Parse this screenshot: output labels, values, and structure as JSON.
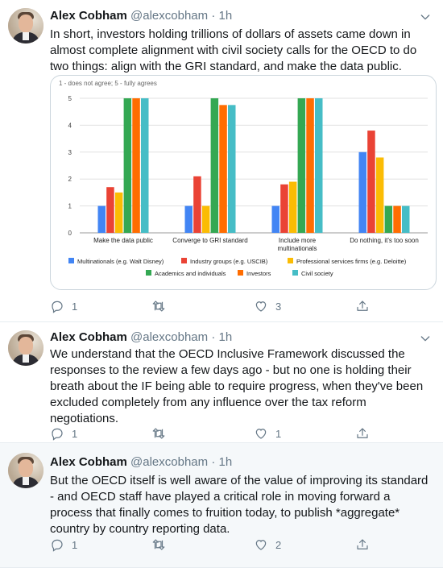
{
  "tweets": [
    {
      "name": "Alex Cobham",
      "handle": "@alexcobham",
      "dot": "·",
      "time": "1h",
      "text": "In short, investors holding trillions of dollars of assets came down in almost complete alignment with civil society calls for the OECD to do two things: align with the GRI standard, and make the data public.",
      "replies": "1",
      "retweets": "",
      "likes": "3"
    },
    {
      "name": "Alex Cobham",
      "handle": "@alexcobham",
      "dot": "·",
      "time": "1h",
      "text": "We understand that the OECD Inclusive Framework discussed the responses to the review a few days ago - but no one is holding their breath about the IF being able to require progress, when they've been excluded completely from any influence over the tax reform negotiations.",
      "replies": "1",
      "retweets": "",
      "likes": "1"
    },
    {
      "name": "Alex Cobham",
      "handle": "@alexcobham",
      "dot": "·",
      "time": "1h",
      "text": "But the OECD itself is well aware of the value of improving its standard - and OECD staff have played a critical role in moving forward a process that finally comes to fruition today, to publish *aggregate* country by country reporting data.",
      "replies": "1",
      "retweets": "",
      "likes": "2"
    }
  ],
  "chart_data": {
    "type": "bar",
    "title": "1 - does not agree; 5 - fully agrees",
    "categories": [
      "Make the data public",
      "Converge to GRI standard",
      "Include more multinationals",
      "Do nothing, it's too soon"
    ],
    "ylim": [
      0,
      5
    ],
    "yticks": [
      "0",
      "1",
      "2",
      "3",
      "4",
      "5"
    ],
    "grid": true,
    "legend_position": "bottom",
    "series": [
      {
        "name": "Multinationals (e.g. Walt Disney)",
        "color": "#4285f4",
        "values": [
          1.0,
          1.0,
          1.0,
          3.0
        ]
      },
      {
        "name": "Industry groups (e.g. USCIB)",
        "color": "#ea4335",
        "values": [
          1.7,
          2.1,
          1.8,
          3.8
        ]
      },
      {
        "name": "Professional services firms (e.g. Deloitte)",
        "color": "#fbbc04",
        "values": [
          1.5,
          1.0,
          1.9,
          2.8
        ]
      },
      {
        "name": "Academics and individuals",
        "color": "#34a853",
        "values": [
          5.0,
          5.0,
          5.0,
          1.0
        ]
      },
      {
        "name": "Investors",
        "color": "#ff6d01",
        "values": [
          5.0,
          4.75,
          5.0,
          1.0
        ]
      },
      {
        "name": "Civil society",
        "color": "#46bdc6",
        "values": [
          5.0,
          4.75,
          5.0,
          1.0
        ]
      }
    ]
  }
}
